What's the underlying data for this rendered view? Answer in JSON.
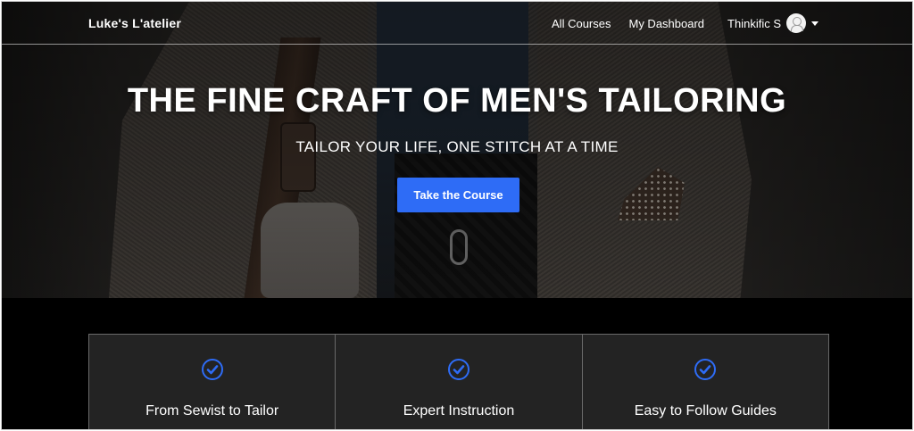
{
  "nav": {
    "brand": "Luke's L'atelier",
    "links": [
      "All Courses",
      "My Dashboard"
    ],
    "user_name": "Thinkific S"
  },
  "hero": {
    "title": "THE FINE CRAFT OF MEN'S TAILORING",
    "subtitle": "TAILOR YOUR LIFE, ONE STITCH AT A TIME",
    "cta_label": "Take the Course"
  },
  "features": [
    {
      "label": "From Sewist to Tailor",
      "icon": "check-circle-icon"
    },
    {
      "label": "Expert Instruction",
      "icon": "check-circle-icon"
    },
    {
      "label": "Easy to Follow Guides",
      "icon": "check-circle-icon"
    }
  ],
  "colors": {
    "accent": "#2e6cf6",
    "background": "#000000",
    "feature_bg": "#232323"
  }
}
